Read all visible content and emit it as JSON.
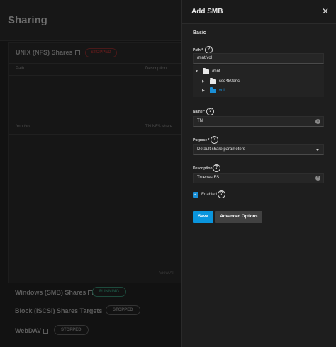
{
  "background_page": {
    "title": "Sharing",
    "nfs_card": {
      "title": "UNIX (NFS) Shares",
      "status": "STOPPED",
      "columns": [
        "Path",
        "Description"
      ],
      "rows": [
        {
          "path": "/mnt/vol",
          "description": "TN NFS share"
        }
      ],
      "view_all": "View All"
    },
    "services": [
      {
        "name": "Windows (SMB) Shares",
        "status": "RUNNING"
      },
      {
        "name": "Block (iSCSI) Shares Targets",
        "status": "STOPPED"
      },
      {
        "name": "WebDAV",
        "status": "STOPPED"
      }
    ]
  },
  "panel": {
    "title": "Add SMB",
    "close_icon": "close-icon",
    "section": "Basic",
    "path": {
      "label": "Path *",
      "value": "/mnt/vol",
      "tree": {
        "root": "/mnt",
        "children": [
          {
            "name": "ssd480enc",
            "selected": false
          },
          {
            "name": "vol",
            "selected": true
          }
        ]
      }
    },
    "name": {
      "label": "Name *",
      "value": "TN"
    },
    "purpose": {
      "label": "Purpose *",
      "value": "Default share parameters"
    },
    "description": {
      "label": "Description",
      "value": "Truenas FS"
    },
    "enabled": {
      "label": "Enabled",
      "checked": true
    },
    "buttons": {
      "save": "Save",
      "advanced": "Advanced Options"
    }
  },
  "colors": {
    "accent": "#0a95dd",
    "panel_bg": "#1e1e1e",
    "overlay_bg": "#121212"
  }
}
